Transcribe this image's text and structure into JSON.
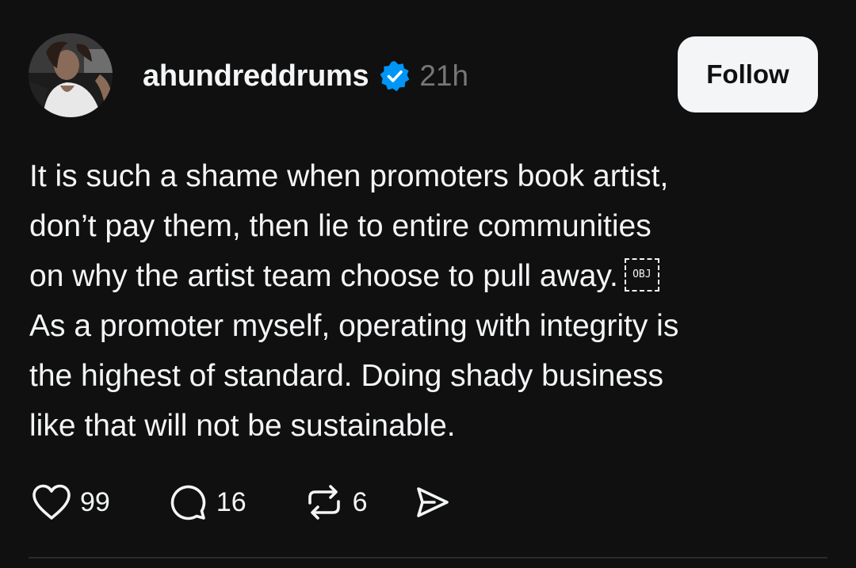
{
  "post": {
    "username": "ahundreddrums",
    "timestamp": "21h",
    "verified_icon": "verified-badge-icon",
    "follow_label": "Follow",
    "body_lines": [
      "It is such a shame when promoters book artist,",
      "don’t pay them, then lie to entire communities",
      "on why the artist team choose to pull away.",
      "As a promoter myself, operating with integrity is",
      "the highest of standard. Doing shady business",
      "like that will not be sustainable."
    ],
    "object_placeholder": "OBJ",
    "actions": {
      "like_count": "99",
      "reply_count": "16",
      "repost_count": "6"
    }
  },
  "colors": {
    "background": "#101010",
    "text": "#f3f5f7",
    "muted": "#777777",
    "verified": "#0095f6",
    "button_bg": "#f3f5f7"
  }
}
